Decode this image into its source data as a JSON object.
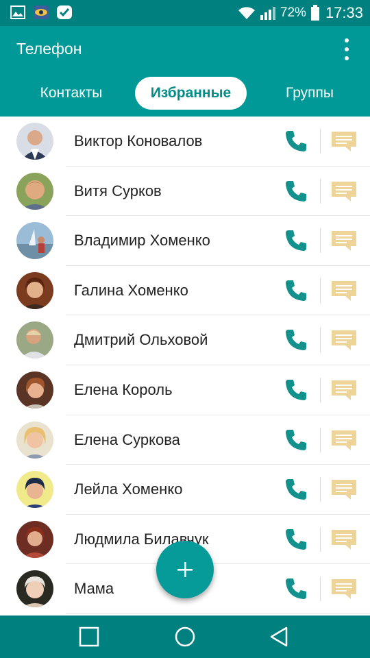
{
  "status_bar": {
    "battery_percent": "72%",
    "time": "17:33",
    "icons": [
      "gallery-icon",
      "eye-app-icon",
      "check-badge-icon",
      "wifi-icon",
      "signal-icon",
      "battery-icon"
    ]
  },
  "app_bar": {
    "title": "Телефон",
    "tabs": [
      {
        "label": "Контакты",
        "selected": false
      },
      {
        "label": "Избранные",
        "selected": true
      },
      {
        "label": "Группы",
        "selected": false
      }
    ]
  },
  "contacts": [
    {
      "name": "Виктор Коновалов"
    },
    {
      "name": "Витя Сурков"
    },
    {
      "name": "Владимир Хоменко"
    },
    {
      "name": "Галина Хоменко"
    },
    {
      "name": "Дмитрий Ольховой"
    },
    {
      "name": "Елена Король"
    },
    {
      "name": "Елена Суркова"
    },
    {
      "name": "Лейла Хоменко"
    },
    {
      "name": "Людмила Билавчук"
    },
    {
      "name": "Мама"
    }
  ],
  "colors": {
    "status_bar": "#00807f",
    "app_bar": "#019997",
    "accent": "#069b98",
    "call_icon": "#13918c",
    "message_icon": "#efd49a"
  },
  "fab": {
    "icon": "plus-icon"
  },
  "nav_bar": {
    "icons": [
      "recents-icon",
      "home-icon",
      "back-icon"
    ]
  }
}
